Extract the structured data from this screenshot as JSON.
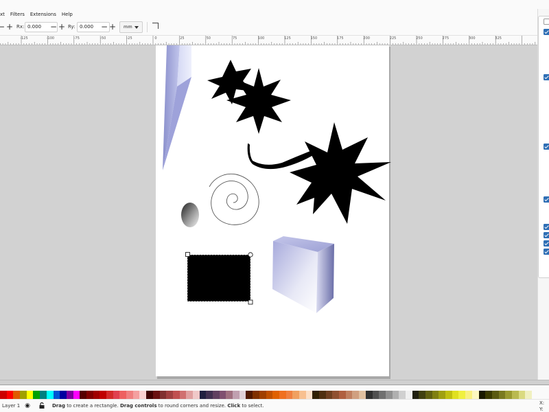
{
  "menubar": {
    "items": [
      "xt",
      "Filters",
      "Extensions",
      "Help"
    ]
  },
  "toolbar": {
    "rx_label": "Rx:",
    "rx_value": "0.000",
    "ry_label": "Ry:",
    "ry_value": "0.000",
    "unit": "mm",
    "minus": "−",
    "plus": "+"
  },
  "ruler": {
    "labels": [
      "-125",
      "-100",
      "-75",
      "-50",
      "-25",
      "0",
      "25",
      "50",
      "75",
      "100",
      "125",
      "150",
      "175",
      "200",
      "225",
      "250",
      "275",
      "300",
      "325"
    ]
  },
  "dock": {
    "checkboxes": [
      false,
      true,
      true,
      true,
      true,
      true,
      true,
      true,
      true
    ]
  },
  "status": {
    "layer": "Layer 1",
    "msg_1": "Drag",
    "msg_2": " to create a rectangle. ",
    "msg_3": "Drag controls",
    "msg_4": " to round corners and resize. ",
    "msg_5": "Click",
    "msg_6": " to select.",
    "x_label": "X:",
    "y_label": "Y:"
  },
  "palette": {
    "colors": [
      "#cc0000",
      "#ff0000",
      "#e05a00",
      "#a0a000",
      "#ffff00",
      "#00a000",
      "#008080",
      "#00ffff",
      "#0055d4",
      "#0000a0",
      "#8000a0",
      "#ff00ff",
      "#550000",
      "#800000",
      "#a00000",
      "#c00000",
      "#d42a2a",
      "#e04050",
      "#ee6060",
      "#f08080",
      "#f4a0a0",
      "#fbd0d0",
      "#400000",
      "#6a1010",
      "#803030",
      "#a04040",
      "#c05050",
      "#d07070",
      "#e0a0a0",
      "#f0c8c8",
      "#202040",
      "#403050",
      "#604060",
      "#805070",
      "#a07080",
      "#c0a0b0",
      "#e0d0d8",
      "#501800",
      "#803000",
      "#a04000",
      "#c05000",
      "#e06000",
      "#f07020",
      "#f08040",
      "#f0a060",
      "#f8c090",
      "#fce0c8",
      "#302000",
      "#503010",
      "#704020",
      "#905030",
      "#b06040",
      "#c08060",
      "#d0a080",
      "#e0c0a0",
      "#303030",
      "#505050",
      "#707070",
      "#909090",
      "#b0b0b0",
      "#d0d0d0",
      "#f0f0f0",
      "#202010",
      "#404010",
      "#606010",
      "#808010",
      "#a0a010",
      "#c0c010",
      "#e0e020",
      "#f0f040",
      "#f8f080",
      "#fcf8c0",
      "#1a1a00",
      "#3a3a00",
      "#5a5a10",
      "#7a7a20",
      "#9a9a30",
      "#baba50",
      "#dada80",
      "#f0f0c0"
    ]
  }
}
